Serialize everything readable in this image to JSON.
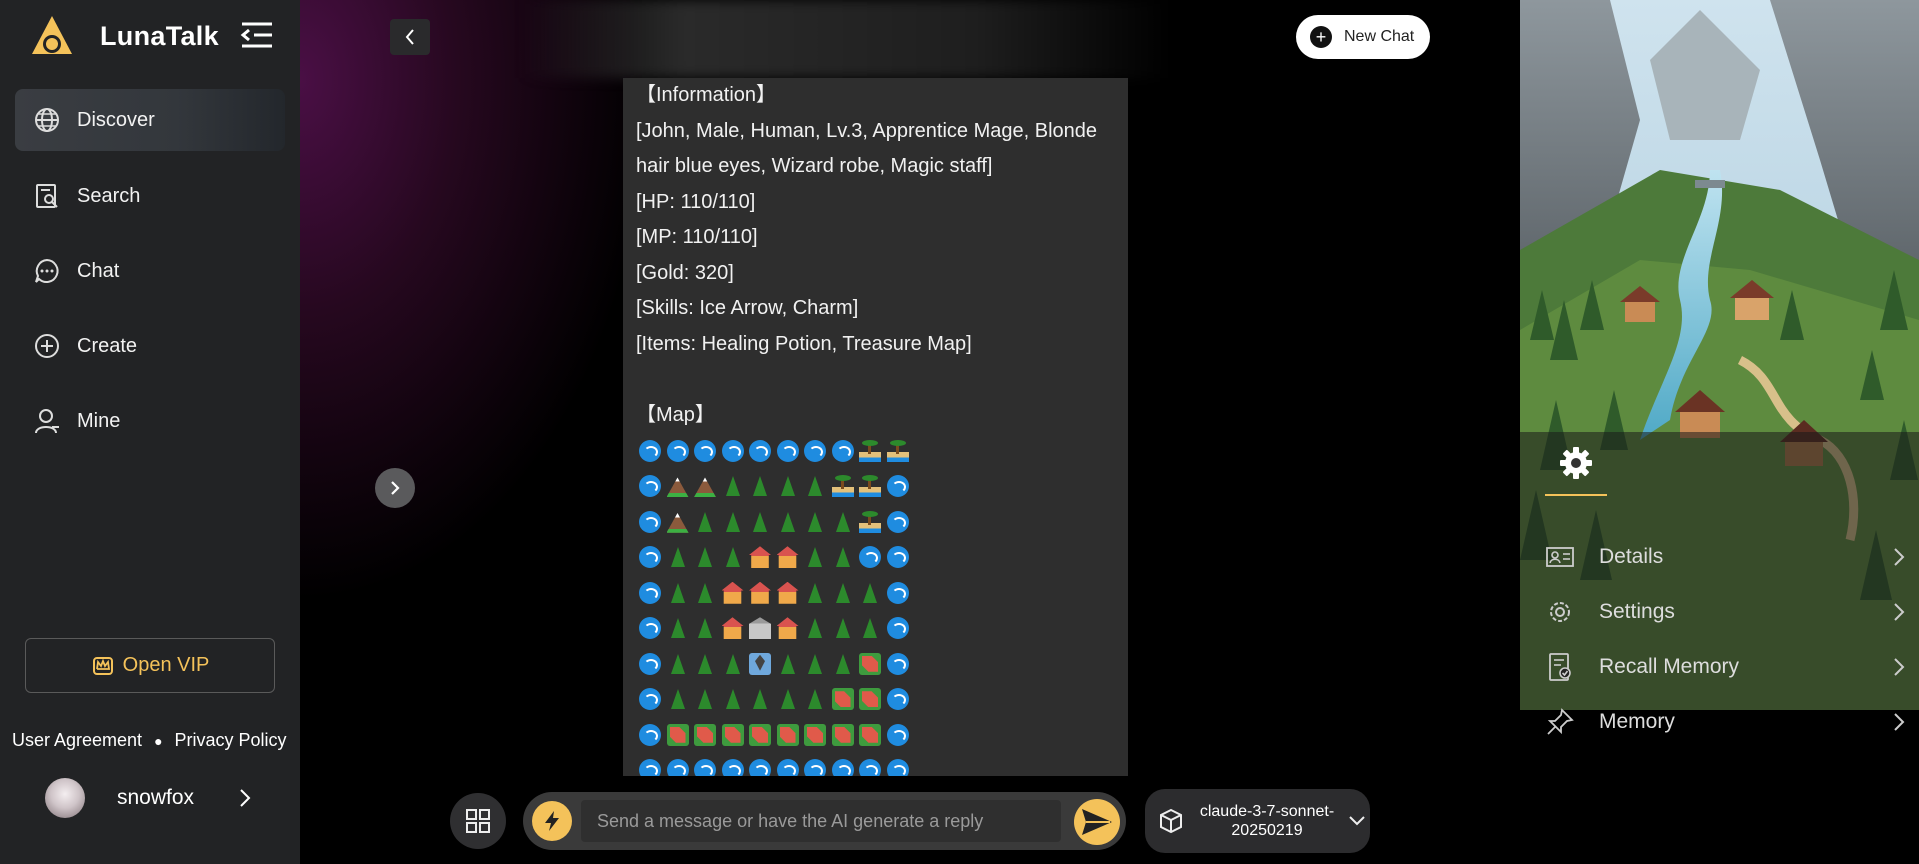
{
  "app": {
    "name": "LunaTalk"
  },
  "nav": [
    {
      "label": "Discover",
      "icon": "globe-icon",
      "active": true
    },
    {
      "label": "Search",
      "icon": "search-doc-icon"
    },
    {
      "label": "Chat",
      "icon": "chat-bubble-icon"
    },
    {
      "label": "Create",
      "icon": "plus-circle-icon"
    },
    {
      "label": "Mine",
      "icon": "user-icon"
    }
  ],
  "vip": {
    "label": "Open VIP"
  },
  "legal": {
    "agreement": "User Agreement",
    "privacy": "Privacy Policy"
  },
  "user": {
    "name": "snowfox"
  },
  "header": {
    "new_chat": "New Chat"
  },
  "message": {
    "lines": [
      "【Information】",
      "[John, Male, Human, Lv.3, Apprentice Mage, Blonde hair blue eyes, Wizard robe, Magic staff]",
      "[HP: 110/110]",
      "[MP: 110/110]",
      "[Gold: 320]",
      "[Skills: Ice Arrow, Charm]",
      "[Items: Healing Potion, Treasure Map]",
      "",
      "【Map】"
    ],
    "map_legend": {
      "W": "water-wave",
      "I": "island",
      "M": "mountain",
      "T": "tree",
      "H": "house",
      "P": "temple",
      "F": "field",
      "X": "pin"
    },
    "map": [
      "WWWWWWWWII",
      "WMMTTTTIIW",
      "WMTTTTTTIW",
      "WTTTHHTTWW",
      "WTTHHHTTTW",
      "WTTHPHTTTW",
      "WTTTXTTTFW",
      "WTTTTTTFFW",
      "WFFFFFFFFW",
      "WWWWWWWWWW"
    ]
  },
  "composer": {
    "placeholder": "Send a message or have the AI generate a reply"
  },
  "model": {
    "name": "claude-3-7-sonnet-20250219"
  },
  "right_panel": {
    "items": [
      {
        "label": "Details",
        "icon": "id-card-icon"
      },
      {
        "label": "Settings",
        "icon": "gear-icon"
      },
      {
        "label": "Recall Memory",
        "icon": "memory-doc-icon"
      },
      {
        "label": "Memory",
        "icon": "pin-icon"
      }
    ]
  },
  "colors": {
    "accent": "#f4c25a",
    "sidebar": "#222325",
    "bubble": "#2e2e2e"
  }
}
